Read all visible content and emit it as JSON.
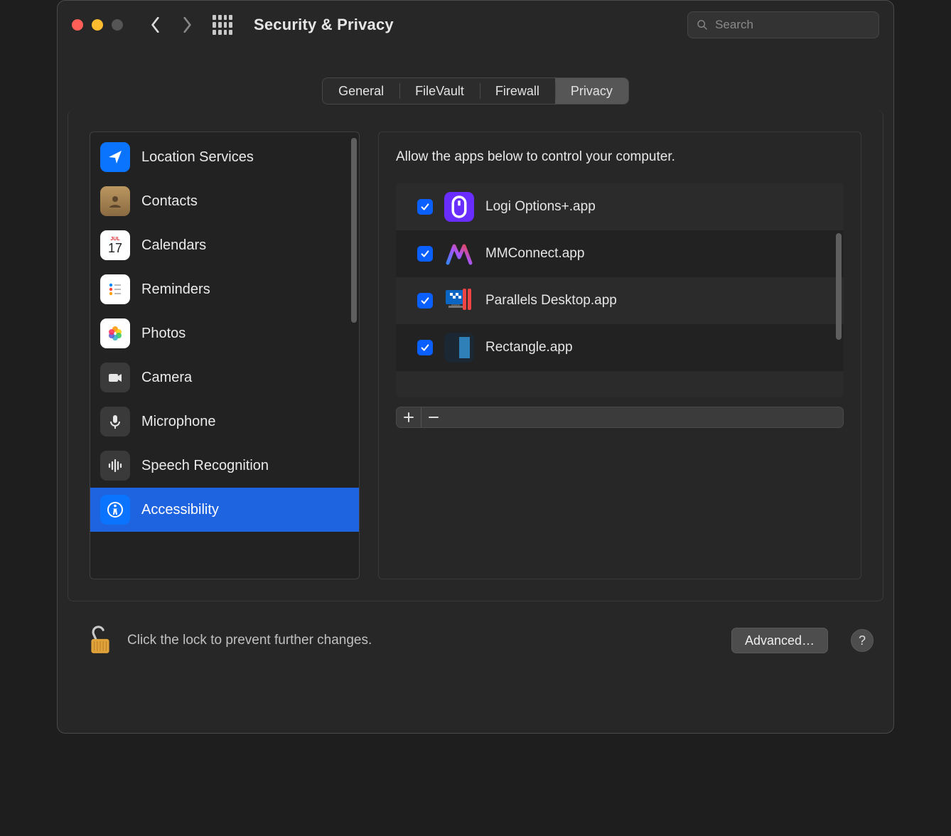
{
  "window": {
    "title": "Security & Privacy"
  },
  "search": {
    "placeholder": "Search"
  },
  "tabs": [
    {
      "label": "General",
      "active": false
    },
    {
      "label": "FileVault",
      "active": false
    },
    {
      "label": "Firewall",
      "active": false
    },
    {
      "label": "Privacy",
      "active": true
    }
  ],
  "sidebar": {
    "items": [
      {
        "label": "Location Services",
        "icon": "location-arrow",
        "bg": "#0a74ff",
        "fg": "#fff"
      },
      {
        "label": "Contacts",
        "icon": "contacts",
        "bg": "#8a6a42",
        "fg": "#fff"
      },
      {
        "label": "Calendars",
        "icon": "calendar",
        "bg": "#ffffff",
        "fg": "#e03030"
      },
      {
        "label": "Reminders",
        "icon": "reminders",
        "bg": "#ffffff",
        "fg": "#555"
      },
      {
        "label": "Photos",
        "icon": "photos",
        "bg": "#ffffff",
        "fg": "#555"
      },
      {
        "label": "Camera",
        "icon": "camera",
        "bg": "#3a3a3a",
        "fg": "#eaeaea"
      },
      {
        "label": "Microphone",
        "icon": "microphone",
        "bg": "#3a3a3a",
        "fg": "#eaeaea"
      },
      {
        "label": "Speech Recognition",
        "icon": "waveform",
        "bg": "#3a3a3a",
        "fg": "#eaeaea"
      },
      {
        "label": "Accessibility",
        "icon": "accessibility",
        "bg": "#0a74ff",
        "fg": "#fff",
        "selected": true
      }
    ]
  },
  "detail": {
    "description": "Allow the apps below to control your computer.",
    "apps": [
      {
        "label": "Logi Options+.app",
        "checked": true,
        "icon": "logi",
        "bg": "#6a2dff"
      },
      {
        "label": "MMConnect.app",
        "checked": true,
        "icon": "mmconnect",
        "bg": "transparent"
      },
      {
        "label": "Parallels Desktop.app",
        "checked": true,
        "icon": "parallels",
        "bg": "transparent"
      },
      {
        "label": "Rectangle.app",
        "checked": true,
        "icon": "rectangle",
        "bg": "#1b2733"
      }
    ]
  },
  "footer": {
    "lock_message": "Click the lock to prevent further changes.",
    "advanced_label": "Advanced…",
    "help_label": "?"
  }
}
